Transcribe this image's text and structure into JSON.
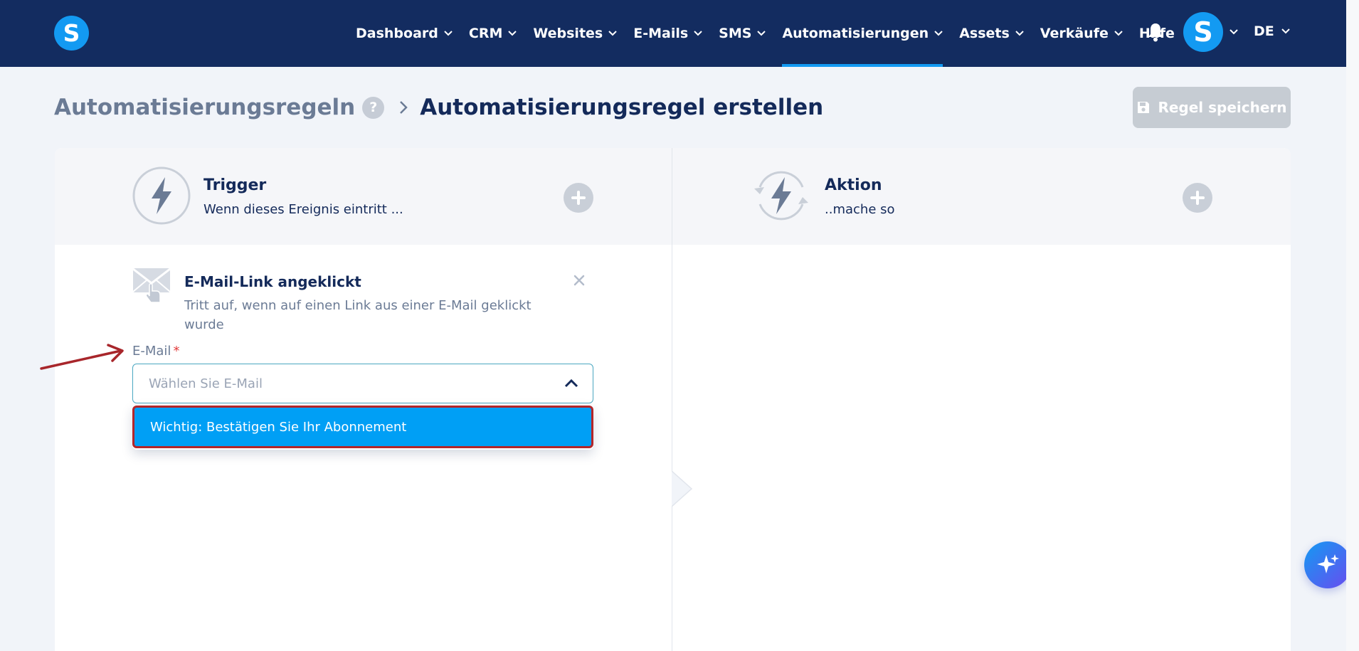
{
  "navbar": {
    "logo_letter": "S",
    "items": [
      {
        "label": "Dashboard",
        "dropdown": true,
        "active": false
      },
      {
        "label": "CRM",
        "dropdown": true,
        "active": false
      },
      {
        "label": "Websites",
        "dropdown": true,
        "active": false
      },
      {
        "label": "E-Mails",
        "dropdown": true,
        "active": false
      },
      {
        "label": "SMS",
        "dropdown": true,
        "active": false
      },
      {
        "label": "Automatisierungen",
        "dropdown": true,
        "active": true
      },
      {
        "label": "Assets",
        "dropdown": true,
        "active": false
      },
      {
        "label": "Verkäufe",
        "dropdown": true,
        "active": false
      },
      {
        "label": "Hilfe",
        "dropdown": false,
        "active": false
      }
    ],
    "icons": {
      "notifications": "bell-icon"
    },
    "avatar_letter": "S",
    "language": "DE"
  },
  "breadcrumb": {
    "parent": "Automatisierungsregeln",
    "help_icon": "?",
    "current": "Automatisierungsregel erstellen"
  },
  "toolbar": {
    "save_label": "Regel speichern",
    "save_icon": "floppy-disk-icon"
  },
  "trigger_panel": {
    "title": "Trigger",
    "subtitle": "Wenn dieses Ereignis eintritt ...",
    "icon": "lightning-bolt-icon"
  },
  "action_panel": {
    "title": "Aktion",
    "subtitle": "..mache so",
    "icon": "lightning-bolt-cycle-icon"
  },
  "trigger": {
    "title": "E-Mail-Link angeklickt",
    "description": "Tritt auf, wenn auf einen Link aus einer E-Mail geklickt wurde",
    "icon": "email-click-icon"
  },
  "email_field": {
    "label": "E-Mail",
    "required_marker": "*",
    "placeholder": "Wählen Sie E-Mail",
    "dropdown_open": true,
    "options": [
      "Wichtig: Bestätigen Sie Ihr Abonnement"
    ]
  },
  "colors": {
    "navbar_bg": "#132c60",
    "accent": "#139af2",
    "option_highlight": "#009ff5",
    "annotation_red": "#b3262a"
  }
}
